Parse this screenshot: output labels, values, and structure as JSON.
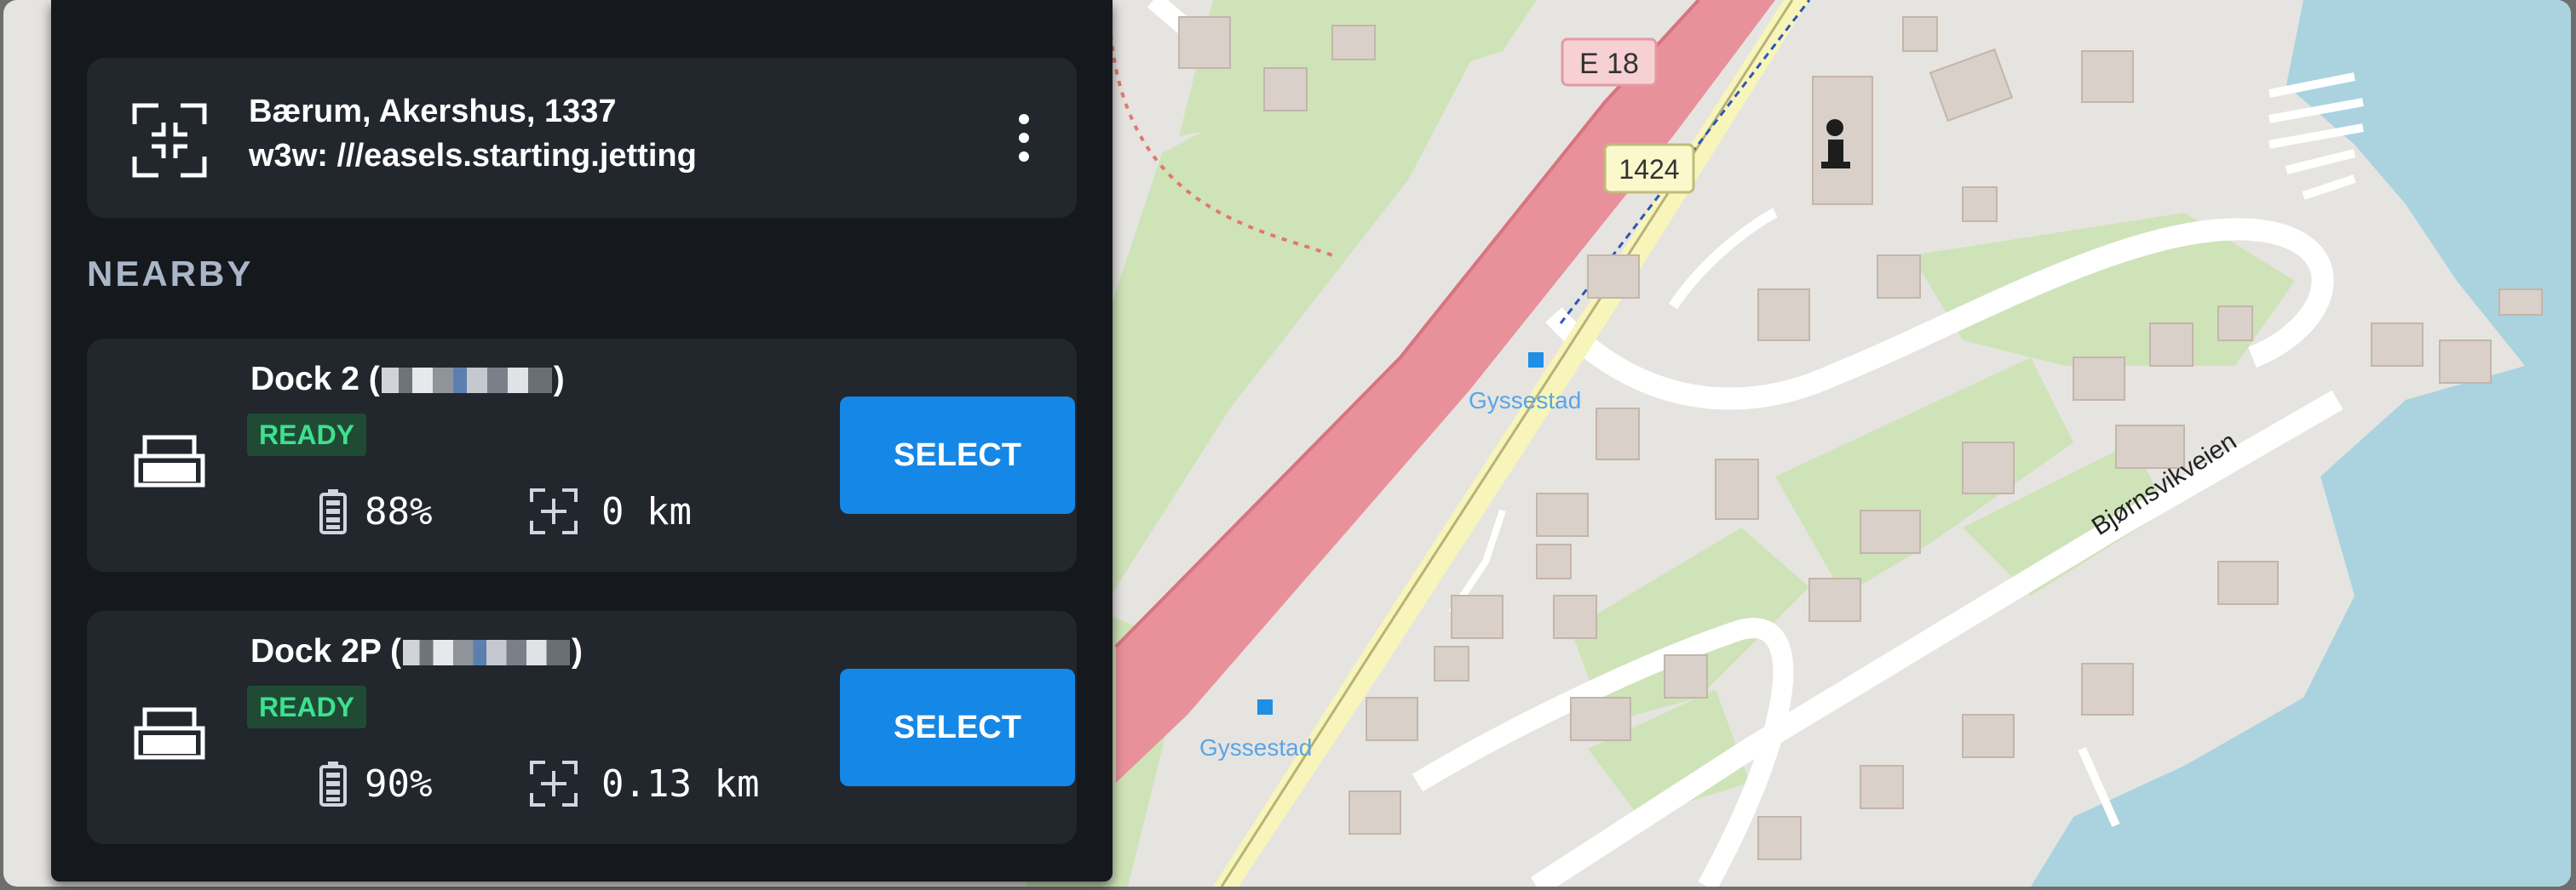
{
  "location": {
    "line1": "Bærum, Akershus, 1337",
    "line2": "w3w: ///easels.starting.jetting",
    "icon": "focus-frame-icon",
    "menu_icon": "more-vertical-icon"
  },
  "nearby": {
    "title": "NEARBY",
    "docks": [
      {
        "name": "Dock 2 (",
        "name_suffix": ")",
        "status": "READY",
        "battery": "88%",
        "distance": "0 km",
        "button": "SELECT",
        "icon": "dock-icon"
      },
      {
        "name": "Dock 2P (",
        "name_suffix": ")",
        "status": "READY",
        "battery": "90%",
        "distance": "0.13 km",
        "button": "SELECT",
        "icon": "dock-icon"
      }
    ]
  },
  "map": {
    "road_labels": [
      "E 18",
      "1424",
      "Bjørnsvikveien"
    ],
    "stop_labels": [
      "Gyssestad",
      "Gyssestad"
    ],
    "poi_icon": "information-icon"
  },
  "colors": {
    "panel_bg": "#15181d",
    "card_bg": "#22262d",
    "accent": "#1587e6",
    "ready_text": "#3ee08e",
    "ready_bg": "#1f4b35",
    "water": "#aad3df",
    "motorway": "#e8919a",
    "secondary_road": "#f7f5b9",
    "park": "#cfe3b8"
  }
}
